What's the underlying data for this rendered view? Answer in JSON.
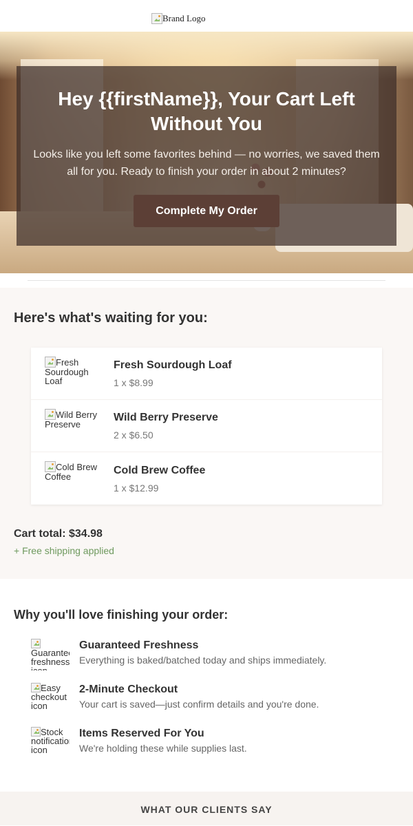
{
  "header": {
    "logo_alt": "Brand Logo"
  },
  "hero": {
    "title": "Hey {{firstName}}, Your Cart Left Without You",
    "text": "Looks like you left some favorites behind — no worries, we saved them all for you. Ready to finish your order in about 2 minutes?",
    "cta_label": "Complete My Order"
  },
  "cart": {
    "heading": "Here's what's waiting for you:",
    "items": [
      {
        "img_alt": "Fresh Sourdough Loaf",
        "name": "Fresh Sourdough Loaf",
        "qty": "1 x $8.99"
      },
      {
        "img_alt": "Wild Berry Preserve",
        "name": "Wild Berry Preserve",
        "qty": "2 x $6.50"
      },
      {
        "img_alt": "Cold Brew Coffee",
        "name": "Cold Brew Coffee",
        "qty": "1 x $12.99"
      }
    ],
    "total": "Cart total: $34.98",
    "shipping": "+ Free shipping applied"
  },
  "why": {
    "heading": "Why you'll love finishing your order:",
    "benefits": [
      {
        "icon_alt": "Guaranteed freshness icon",
        "title": "Guaranteed Freshness",
        "desc": "Everything is baked/batched today and ships immediately."
      },
      {
        "icon_alt": "Easy checkout icon",
        "title": "2-Minute Checkout",
        "desc": "Your cart is saved—just confirm details and you're done."
      },
      {
        "icon_alt": "Stock notification icon",
        "title": "Items Reserved For You",
        "desc": "We're holding these while supplies last."
      }
    ]
  },
  "clients": {
    "heading": "WHAT OUR CLIENTS SAY"
  },
  "colors": {
    "cta_bg": "#5c3f36",
    "cart_bg": "#faf7f5",
    "shipping": "#6f9a5f",
    "clients_bg": "#f7f3f0"
  }
}
